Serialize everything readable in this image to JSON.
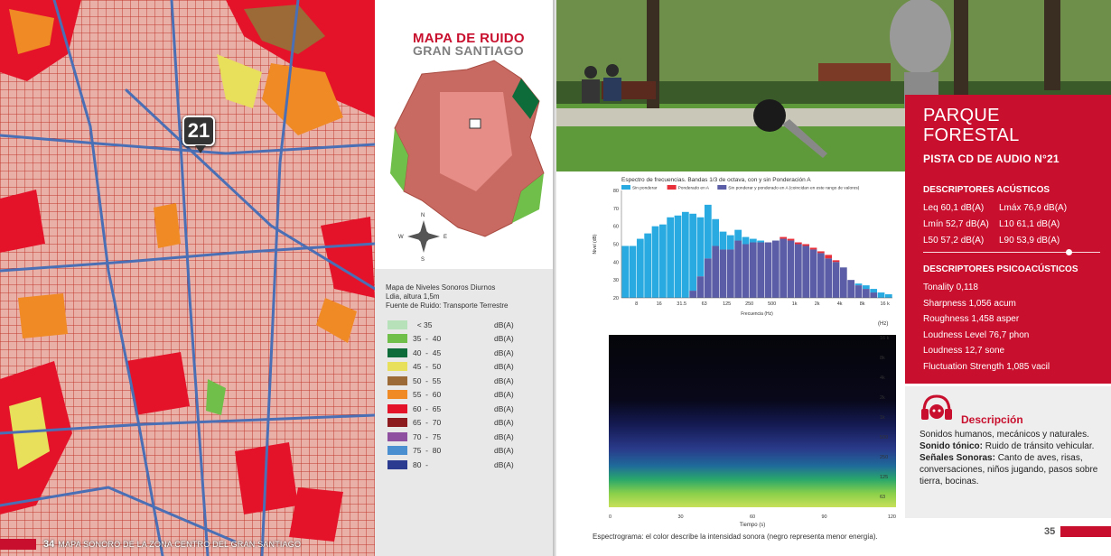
{
  "left_page": {
    "map_marker": "21",
    "footer_page": "34",
    "footer_text": "MAPA SONORO DE LA ZONA CENTRO DEL GRAN SANTIAGO",
    "map_title": "MAPA DE RUIDO",
    "map_subtitle": "GRAN SANTIAGO",
    "compass": {
      "n": "N",
      "s": "S",
      "e": "E",
      "w": "W"
    },
    "legend_head": [
      "Mapa de Niveles Sonoros Diurnos",
      "Ldia, altura 1,5m",
      "Fuente de Ruido: Transporte Terrestre"
    ],
    "legend": [
      {
        "range": "  < 35",
        "unit": "dB(A)",
        "color": "#b7e1b9"
      },
      {
        "range": "35  -  40",
        "unit": "dB(A)",
        "color": "#6fbf4a"
      },
      {
        "range": "40  -  45",
        "unit": "dB(A)",
        "color": "#0e6b3a"
      },
      {
        "range": "45  -  50",
        "unit": "dB(A)",
        "color": "#e8e05a"
      },
      {
        "range": "50  -  55",
        "unit": "dB(A)",
        "color": "#9b6a37"
      },
      {
        "range": "55  -  60",
        "unit": "dB(A)",
        "color": "#f08a24"
      },
      {
        "range": "60  -  65",
        "unit": "dB(A)",
        "color": "#e5132a"
      },
      {
        "range": "65  -  70",
        "unit": "dB(A)",
        "color": "#8b1b1f"
      },
      {
        "range": "70  -  75",
        "unit": "dB(A)",
        "color": "#8e4fa1"
      },
      {
        "range": "75  -  80",
        "unit": "dB(A)",
        "color": "#4a8fcf"
      },
      {
        "range": "80  -",
        "unit": "dB(A)",
        "color": "#2b3b8f"
      }
    ]
  },
  "right_page": {
    "park_title_line1": "PARQUE",
    "park_title_line2": "FORESTAL",
    "track": "PISTA CD DE AUDIO N°21",
    "acoustic_title": "DESCRIPTORES ACÚSTICOS",
    "acoustic": [
      [
        "Leq 60,1 dB(A)",
        "Lmáx 76,9 dB(A)"
      ],
      [
        "Lmín 52,7 dB(A)",
        "L10 61,1 dB(A)"
      ],
      [
        "L50 57,2 dB(A)",
        "L90 53,9 dB(A)"
      ]
    ],
    "psycho_title": "DESCRIPTORES PSICOACÚSTICOS",
    "psycho": [
      "Tonality 0,118",
      "Sharpness 1,056 acum",
      "Roughness 1,458 asper",
      "Loudness Level 76,7 phon",
      "Loudness 12,7 sone",
      "Fluctuation Strength 1,085 vacil"
    ],
    "description_title": "Descripción",
    "desc_p1": "Sonidos humanos, mecánicos y naturales.",
    "desc_tonic_label": "Sonido tónico:",
    "desc_tonic": " Ruido de tránsito vehicular.",
    "desc_signals_label": "Señales Sonoras:",
    "desc_signals": " Canto de aves, risas, conversaciones, niños jugando, pasos sobre tierra, bocinas.",
    "spec_caption": "Espectrograma: el color describe la intensidad sonora (negro representa menor energía).",
    "footer_page": "35",
    "spectrogram": {
      "y_unit": "(Hz)",
      "y_ticks": [
        "16 k",
        "8k",
        "4k",
        "2k",
        "1k",
        "500",
        "250",
        "125",
        "63"
      ],
      "x_ticks": [
        "0",
        "30",
        "60",
        "90",
        "120"
      ],
      "xlabel": "Tiempo (s)"
    }
  },
  "chart_data": {
    "type": "bar",
    "title": "Espectro de frecuencias. Bandas 1/3 de octava, con y sin Ponderación A",
    "legend": [
      {
        "name": "Sin ponderar",
        "color": "#29abe2"
      },
      {
        "name": "Ponderado en A",
        "color": "#e8303a"
      },
      {
        "name": "Sin ponderar y ponderado en A (coincidan en este rango de valores)",
        "color": "#5b5ea6"
      }
    ],
    "xlabel": "Frecuencia (Hz)",
    "ylabel": "Nivel (dB)",
    "ylim": [
      20,
      80
    ],
    "y_ticks": [
      20,
      30,
      40,
      50,
      60,
      70,
      80
    ],
    "x_tick_labels": [
      "8",
      "16",
      "31.5",
      "63",
      "125",
      "250",
      "500",
      "1k",
      "2k",
      "4k",
      "8k",
      "16 k"
    ],
    "x_tick_band_index": [
      0,
      3,
      6,
      9,
      12,
      15,
      18,
      21,
      24,
      27,
      30,
      33
    ],
    "bands": [
      "6.3",
      "8",
      "10",
      "12.5",
      "16",
      "20",
      "25",
      "31.5",
      "40",
      "50",
      "63",
      "80",
      "100",
      "125",
      "160",
      "200",
      "250",
      "315",
      "400",
      "500",
      "630",
      "800",
      "1k",
      "1.25k",
      "1.6k",
      "2k",
      "2.5k",
      "3.15k",
      "4k",
      "5k",
      "6.3k",
      "8k",
      "10k",
      "12.5k",
      "16k",
      "20k"
    ],
    "series": [
      {
        "name": "Sin ponderar",
        "values": [
          49,
          49,
          53,
          56,
          60,
          61,
          65,
          66,
          68,
          67,
          65,
          72,
          64,
          57,
          55,
          58,
          54,
          53,
          52,
          51,
          52,
          53,
          52,
          50,
          49,
          47,
          45,
          42,
          40,
          37,
          30,
          28,
          27,
          25,
          23,
          22
        ]
      },
      {
        "name": "Ponderado en A",
        "values": [
          0,
          0,
          0,
          0,
          0,
          0,
          0,
          0,
          0,
          24,
          32,
          42,
          49,
          47,
          47,
          52,
          50,
          51,
          51,
          51,
          52,
          54,
          53,
          51,
          50,
          48,
          46,
          44,
          41,
          37,
          30,
          27,
          25,
          23,
          20,
          20
        ]
      }
    ]
  }
}
